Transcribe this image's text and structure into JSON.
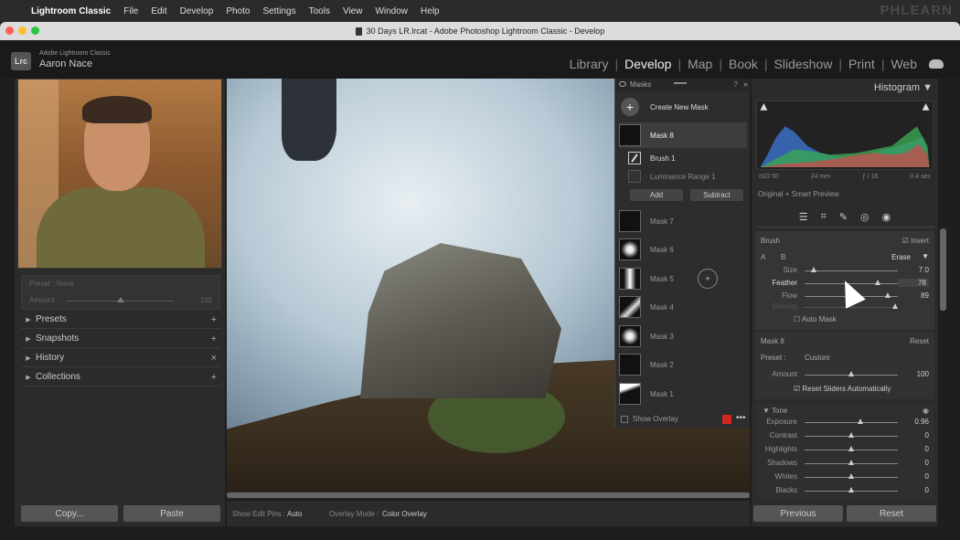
{
  "menubar": {
    "items": [
      "Lightroom Classic",
      "File",
      "Edit",
      "Develop",
      "Photo",
      "Settings",
      "Tools",
      "View",
      "Window",
      "Help"
    ],
    "watermark": "PHLEARN"
  },
  "window": {
    "title": "30 Days LR.lrcat - Adobe Photoshop Lightroom Classic - Develop"
  },
  "identity": {
    "badge": "Lrc",
    "app_name": "Adobe Lightroom Classic",
    "user": "Aaron Nace"
  },
  "modules": [
    "Library",
    "Develop",
    "Map",
    "Book",
    "Slideshow",
    "Print",
    "Web"
  ],
  "active_module": "Develop",
  "left_panel": {
    "preset_label": "Preset : None",
    "amount_label": "Amount",
    "amount_value": "100",
    "sections": [
      {
        "label": "Presets",
        "action": "+"
      },
      {
        "label": "Snapshots",
        "action": "+"
      },
      {
        "label": "History",
        "action": "×"
      },
      {
        "label": "Collections",
        "action": "+"
      }
    ],
    "copy_label": "Copy...",
    "paste_label": "Paste"
  },
  "masks": {
    "title": "Masks",
    "create_label": "Create New Mask",
    "selected": "Mask 8",
    "brush_label": "Brush 1",
    "luminance_label": "Luminance Range 1",
    "add_label": "Add",
    "subtract_label": "Subtract",
    "list": [
      "Mask 7",
      "Mask 6",
      "Mask 5",
      "Mask 4",
      "Mask 3",
      "Mask 2",
      "Mask 1"
    ],
    "show_overlay_label": "Show Overlay",
    "overlay_color": "#d2261e"
  },
  "toolbar": {
    "pins_label": "Show Edit Pins :",
    "pins_value": "Auto",
    "overlay_label": "Overlay Mode :",
    "overlay_value": "Color Overlay"
  },
  "right_panel": {
    "histogram_title": "Histogram",
    "hist_info": [
      "ISO 50",
      "24 mm",
      "ƒ / 16",
      "0.4 sec"
    ],
    "smart_preview": "Original + Smart Preview",
    "brush": {
      "title": "Brush",
      "invert_label": "Invert",
      "a_label": "A",
      "b_label": "B",
      "erase_label": "Erase",
      "size_label": "Size",
      "size_value": "7.0",
      "size_pos": 0.1,
      "feather_label": "Feather",
      "feather_value": "78",
      "feather_pos": 0.78,
      "flow_label": "Flow",
      "flow_value": "89",
      "flow_pos": 0.89,
      "density_label": "Density",
      "density_pos": 0.97,
      "auto_mask_label": "Auto Mask"
    },
    "mask8": {
      "title": "Mask 8",
      "reset_label": "Reset",
      "preset_label": "Preset :",
      "preset_value": "Custom",
      "amount_label": "Amount",
      "amount_value": "100",
      "amount_pos": 0.5,
      "reset_sliders_label": "Reset Sliders Automatically"
    },
    "tone": {
      "title": "Tone",
      "sliders": [
        {
          "label": "Exposure",
          "value": "0.96",
          "pos": 0.6
        },
        {
          "label": "Contrast",
          "value": "0",
          "pos": 0.5
        },
        {
          "label": "Highlights",
          "value": "0",
          "pos": 0.5
        },
        {
          "label": "Shadows",
          "value": "0",
          "pos": 0.5
        },
        {
          "label": "Whites",
          "value": "0",
          "pos": 0.5
        },
        {
          "label": "Blacks",
          "value": "0",
          "pos": 0.5
        }
      ]
    },
    "previous_label": "Previous",
    "reset_label": "Reset"
  }
}
